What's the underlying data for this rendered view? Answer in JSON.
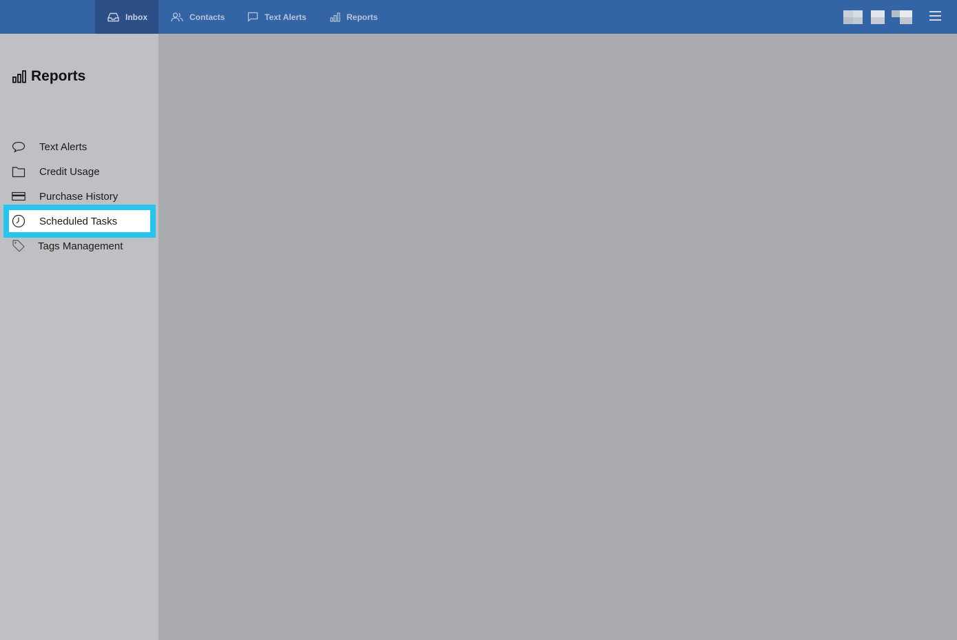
{
  "nav": {
    "tabs": [
      {
        "label": "Inbox",
        "icon": "inbox-icon",
        "active": true
      },
      {
        "label": "Contacts",
        "icon": "users-icon",
        "active": false
      },
      {
        "label": "Text Alerts",
        "icon": "message-icon",
        "active": false
      },
      {
        "label": "Reports",
        "icon": "bar-chart-icon",
        "active": false
      }
    ]
  },
  "sidebar": {
    "title": "Reports",
    "items": [
      {
        "label": "Text Alerts",
        "icon": "speech-bubble-icon"
      },
      {
        "label": "Credit Usage",
        "icon": "folder-icon"
      },
      {
        "label": "Purchase History",
        "icon": "credit-card-icon"
      },
      {
        "label": "Scheduled Tasks",
        "icon": "clock-icon",
        "highlighted": true
      },
      {
        "label": "Tags Management",
        "icon": "tag-icon"
      }
    ]
  },
  "colors": {
    "topbar": "#3364a6",
    "active_tab": "#2b4f86",
    "highlight": "#27c4f0",
    "sidebar": "#bfc0c3",
    "main": "#a9abae"
  }
}
